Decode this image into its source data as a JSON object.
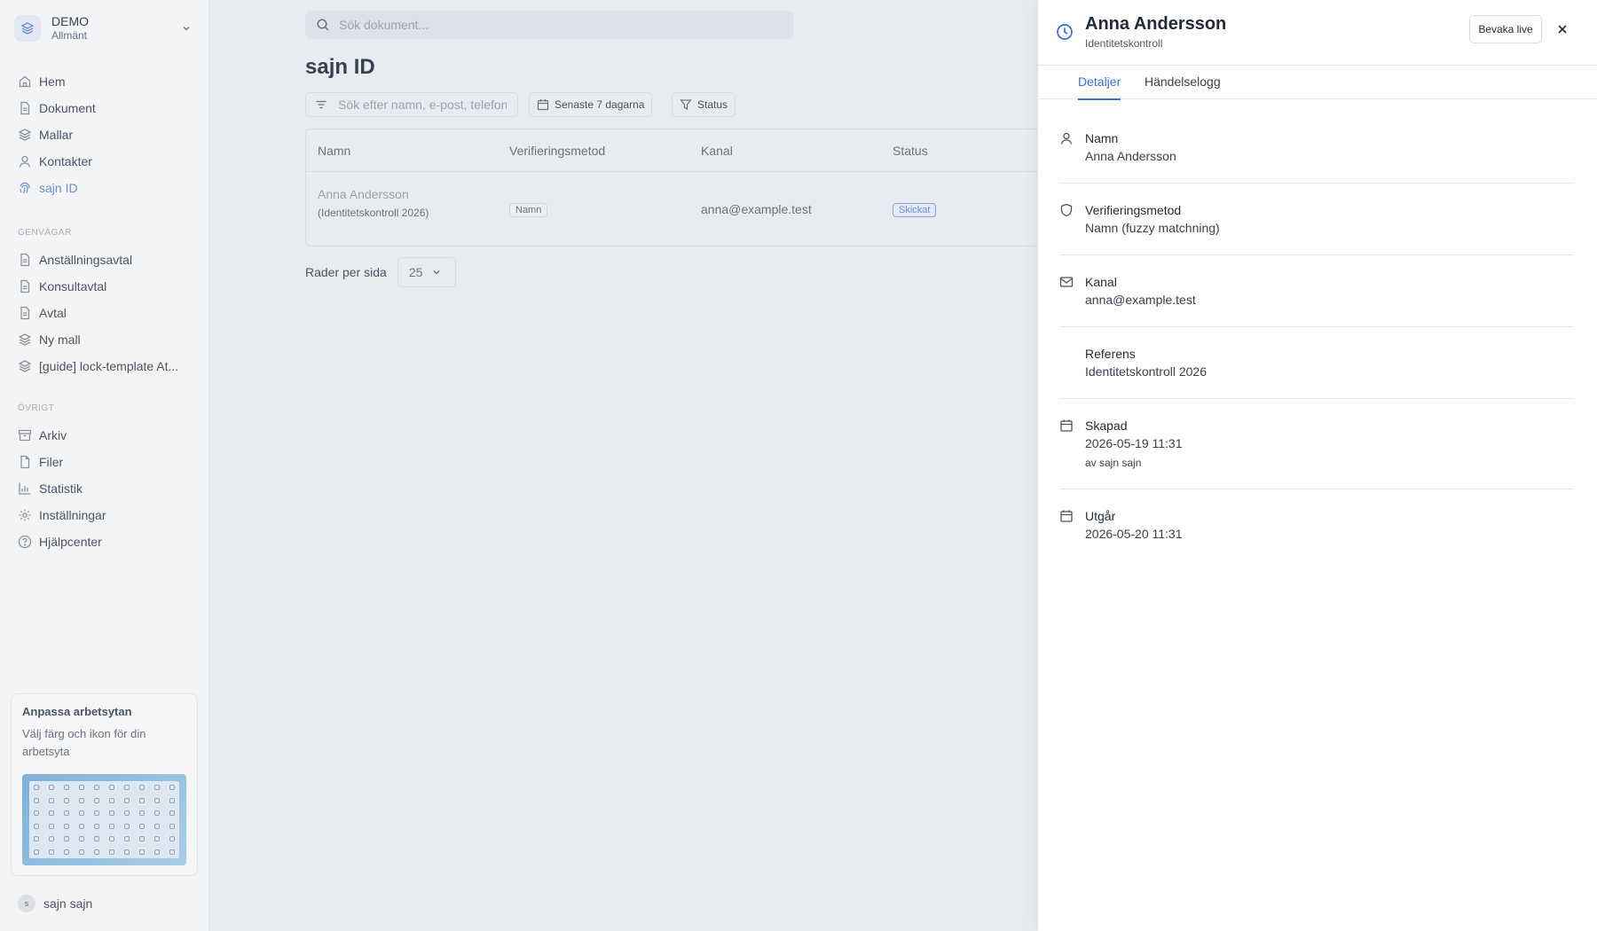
{
  "workspace": {
    "name": "DEMO",
    "subtitle": "Allmänt"
  },
  "sidebar": {
    "main_items": [
      {
        "label": "Hem",
        "icon": "home-icon"
      },
      {
        "label": "Dokument",
        "icon": "document-icon"
      },
      {
        "label": "Mallar",
        "icon": "layers-icon"
      },
      {
        "label": "Kontakter",
        "icon": "user-icon"
      },
      {
        "label": "sajn ID",
        "icon": "fingerprint-icon",
        "active": true
      }
    ],
    "shortcuts_heading": "GENVÄGAR",
    "shortcuts": [
      {
        "label": "Anställningsavtal",
        "icon": "document-icon"
      },
      {
        "label": "Konsultavtal",
        "icon": "document-icon"
      },
      {
        "label": "Avtal",
        "icon": "document-icon"
      },
      {
        "label": "Ny mall",
        "icon": "layers-icon"
      },
      {
        "label": "[guide] lock-template At...",
        "icon": "layers-icon"
      }
    ],
    "other_heading": "ÖVRIGT",
    "other": [
      {
        "label": "Arkiv",
        "icon": "archive-icon"
      },
      {
        "label": "Filer",
        "icon": "file-icon"
      },
      {
        "label": "Statistik",
        "icon": "bar-chart-icon"
      },
      {
        "label": "Inställningar",
        "icon": "gear-icon"
      },
      {
        "label": "Hjälpcenter",
        "icon": "help-icon"
      }
    ],
    "customize": {
      "title": "Anpassa arbetsytan",
      "description": "Välj färg och ikon för din arbetsyta"
    },
    "user": {
      "initial": "s",
      "name": "sajn sajn"
    }
  },
  "search": {
    "placeholder": "Sök dokument..."
  },
  "page": {
    "title": "sajn ID"
  },
  "filters": {
    "search_placeholder": "Sök efter namn, e-post, telefon",
    "date_label": "Senaste 7 dagarna",
    "status_label": "Status"
  },
  "table": {
    "columns": [
      "Namn",
      "Verifieringsmetod",
      "Kanal",
      "Status"
    ],
    "rows": [
      {
        "name": "Anna Andersson",
        "reference": "(Identitetskontroll 2026)",
        "method": "Namn",
        "channel": "anna@example.test",
        "status": "Skickat"
      }
    ]
  },
  "pagination": {
    "label": "Rader per sida",
    "value": "25"
  },
  "drawer": {
    "title": "Anna Andersson",
    "subtitle": "Identitetskontroll",
    "watch_label": "Bevaka live",
    "tabs": [
      "Detaljer",
      "Händelselogg"
    ],
    "details": [
      {
        "label": "Namn",
        "value": "Anna Andersson",
        "icon": "user-icon"
      },
      {
        "label": "Verifieringsmetod",
        "value": "Namn (fuzzy matchning)",
        "icon": "shield-icon"
      },
      {
        "label": "Kanal",
        "value": "anna@example.test",
        "icon": "mail-icon"
      },
      {
        "label": "Referens",
        "value": "Identitetskontroll 2026",
        "icon": ""
      },
      {
        "label": "Skapad",
        "value": "2026-05-19 11:31",
        "extra": "av sajn sajn",
        "icon": "calendar-icon"
      },
      {
        "label": "Utgår",
        "value": "2026-05-20 11:31",
        "icon": "calendar-icon"
      }
    ]
  },
  "colors": {
    "accent": "#3b6fd8",
    "active_nav": "#6b8ed6",
    "overlay_bg": "#e8ebf0"
  }
}
